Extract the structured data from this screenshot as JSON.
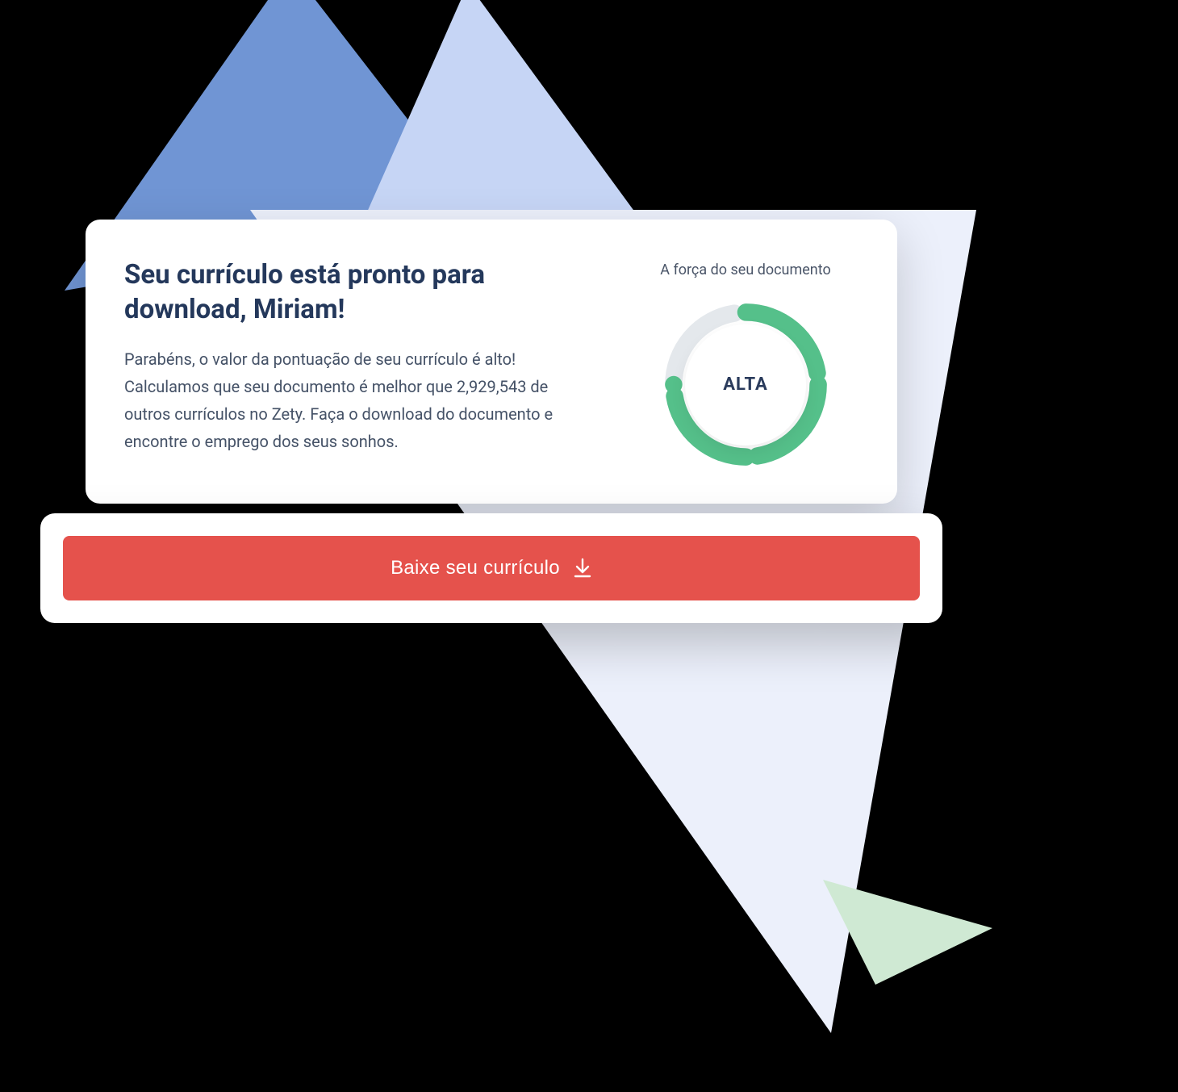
{
  "card": {
    "title": "Seu currículo está pronto para download, Miriam!",
    "body": "Parabéns, o valor da pontuação de seu currículo é alto! Calculamos que seu documento é melhor que 2,929,543 de outros currículos no Zety. Faça o down­load do documento e encontre o emprego dos seus sonhos."
  },
  "gauge": {
    "caption": "A força do seu documento",
    "label": "ALTA",
    "percent": 75
  },
  "button": {
    "label": "Baixe seu currículo"
  },
  "colors": {
    "accent": "#e5524c",
    "gauge_fill": "#55c08a",
    "gauge_track": "#e4e8ec",
    "text_heading": "#24385b",
    "text_body": "#455267"
  }
}
